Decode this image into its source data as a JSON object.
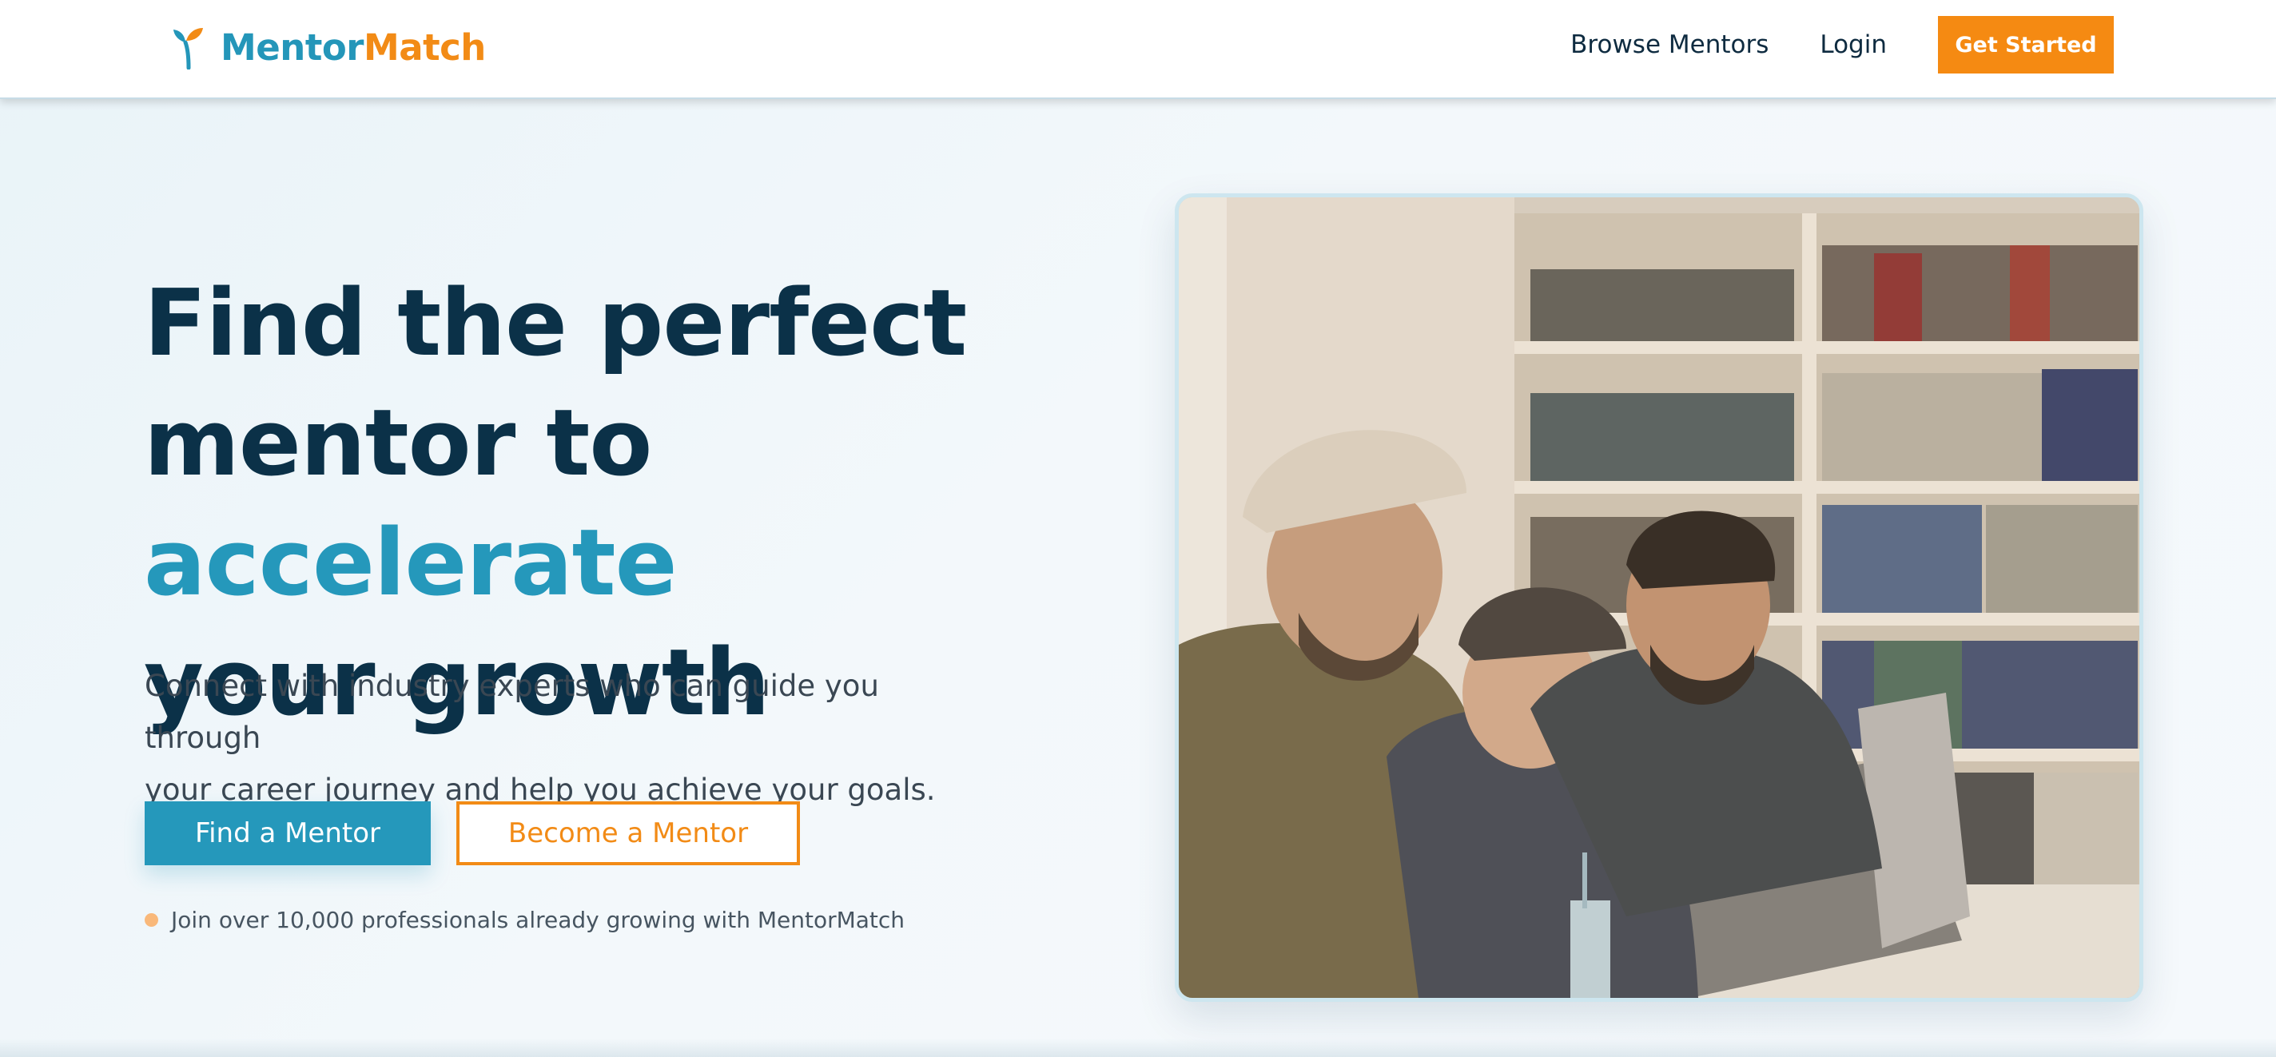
{
  "brand": {
    "name_part_1": "Mentor",
    "name_part_2": "Match",
    "color_primary": "#2496b9",
    "color_accent": "#f28b16",
    "logo_icon": "sprout-icon"
  },
  "nav": {
    "browse_mentors": "Browse Mentors",
    "login": "Login",
    "get_started": "Get Started"
  },
  "hero": {
    "title_line_1": "Find the perfect",
    "title_line_2_prefix": "mentor to ",
    "title_highlight": "accelerate",
    "title_line_3": "your growth",
    "subtitle_line_1": "Connect with industry experts who can guide you through",
    "subtitle_line_2": "your career journey and help you achieve your goals.",
    "primary_cta": "Find a Mentor",
    "secondary_cta": "Become a Mentor",
    "social_proof": "Join over 10,000 professionals already growing with MentorMatch"
  }
}
